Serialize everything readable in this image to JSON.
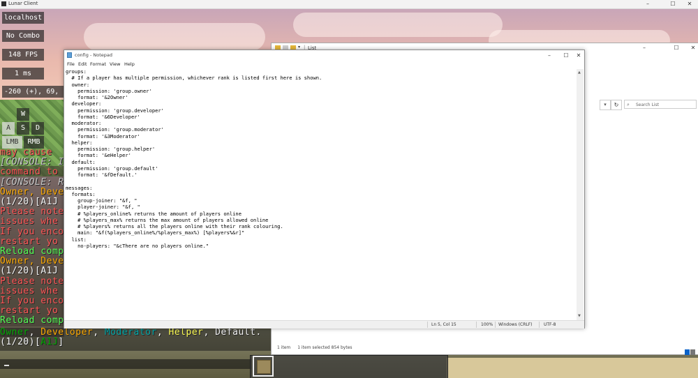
{
  "lunar_window": {
    "title": "Lunar Client",
    "controls": [
      "–",
      "☐",
      "✕"
    ]
  },
  "hud": {
    "server": "localhost",
    "combo": "No Combo",
    "fps": "148 FPS",
    "ping": "1 ms",
    "coords": "-260 (+), 69, 17",
    "keys": {
      "w": "W",
      "a": "A",
      "s": "S",
      "d": "D",
      "lmb": "LMB",
      "rmb": "RMB"
    }
  },
  "chat": {
    "lines": [
      {
        "text": "may cause",
        "color": "red"
      },
      {
        "text": "[CONSOLE: I",
        "color": "grey"
      },
      {
        "text": " command to",
        "color": "red"
      },
      {
        "text": "[CONSOLE: R",
        "color": "grey"
      },
      {
        "text": "Owner, Devel",
        "color": "mix1"
      },
      {
        "text": "(1/20)[A1J",
        "color": "mix2"
      },
      {
        "text": "Please note",
        "color": "red"
      },
      {
        "text": " issues whe",
        "color": "red"
      },
      {
        "text": "If you enco",
        "color": "red"
      },
      {
        "text": " restart yo",
        "color": "red"
      },
      {
        "text": "Reload comp",
        "color": "green"
      },
      {
        "text": "Owner, Devel",
        "color": "mix1"
      },
      {
        "text": "(1/20)[A1J",
        "color": "mix2"
      },
      {
        "text": "Please note",
        "color": "red"
      },
      {
        "text": " issues whe",
        "color": "red"
      },
      {
        "text": "If you enco",
        "color": "red"
      },
      {
        "text": " restart yo",
        "color": "red"
      },
      {
        "text": "Reload comp",
        "color": "green"
      }
    ],
    "final_line": {
      "owner": "Owner",
      "developer": "Developer",
      "moderator": "Moderator",
      "helper": "Helper",
      "default": "Default."
    },
    "count_line": {
      "count": "(1/20)",
      "name": "A1J"
    },
    "input_cursor": "_"
  },
  "explorer": {
    "title": "List",
    "controls": [
      "–",
      "☐",
      "✕"
    ],
    "search_placeholder": "Search List",
    "status_items": "1 item",
    "status_selected": "1 item selected  854 bytes"
  },
  "notepad": {
    "title": "config - Notepad",
    "controls": [
      "–",
      "☐",
      "✕"
    ],
    "menu": [
      "File",
      "Edit",
      "Format",
      "View",
      "Help"
    ],
    "content": "groups:\n  # If a player has multiple permission, whichever rank is listed first here is shown.\n  owner:\n    permission: 'group.owner'\n    format: '&2Owner'\n  developer:\n    permission: 'group.developer'\n    format: '&6Developer'\n  moderator:\n    permission: 'group.moderator'\n    format: '&3Moderator'\n  helper:\n    permission: 'group.helper'\n    format: '&eHelper'\n  default:\n    permission: 'group.default'\n    format: '&fDefault.'\n\nmessages:\n  formats:\n    group-joiner: \"&f, \"\n    player-joiner: \"&f, \"\n    # %players_online% returns the amount of players online\n    # %players_max% returns the max amount of players allowed online\n    # %players% returns all the players online with their rank colouring.\n    main: \"&f(%players_online%/%players_max%) [%players%&r]\"\n  list:\n    no-players: \"&cThere are no players online.\"",
    "status": {
      "position": "Ln 5, Col 15",
      "zoom": "100%",
      "line_ending": "Windows (CRLF)",
      "encoding": "UTF-8"
    }
  }
}
